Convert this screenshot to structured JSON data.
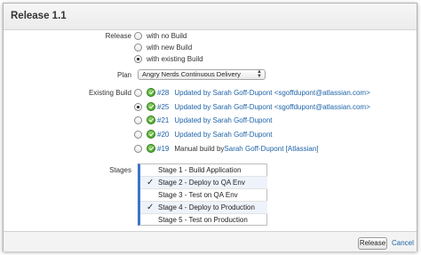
{
  "dialog": {
    "title": "Release 1.1",
    "release_button": "Release",
    "cancel_label": "Cancel"
  },
  "release": {
    "label": "Release",
    "options": [
      {
        "label": "with no Build",
        "checked": false
      },
      {
        "label": "with new Build",
        "checked": false
      },
      {
        "label": "with existing Build",
        "checked": true
      }
    ]
  },
  "plan": {
    "label": "Plan",
    "selected": "Angry Nerds Continuous Delivery"
  },
  "existing_build": {
    "label": "Existing Build",
    "builds": [
      {
        "number": "#28",
        "text": "Updated by Sarah Goff-Dupont <sgoffdupont@atlassian.com>",
        "checked": false
      },
      {
        "number": "#25",
        "text": "Updated by Sarah Goff-Dupont <sgoffdupont@atlassian.com>",
        "checked": true
      },
      {
        "number": "#21",
        "text": "Updated by Sarah Goff-Dupont",
        "checked": false
      },
      {
        "number": "#20",
        "text": "Updated by Sarah Goff-Dupont",
        "checked": false
      },
      {
        "number": "#19",
        "prefix": "Manual build by ",
        "text": "Sarah Goff-Dupont [Atlassian]",
        "checked": false
      }
    ]
  },
  "stages": {
    "label": "Stages",
    "items": [
      {
        "label": "Stage 1 - Build Application",
        "checked": false
      },
      {
        "label": "Stage 2 - Deploy to QA Env",
        "checked": true
      },
      {
        "label": "Stage 3 - Test on QA Env",
        "checked": false
      },
      {
        "label": "Stage 4 - Deploy to Production",
        "checked": true
      },
      {
        "label": "Stage 5 - Test on Production",
        "checked": false
      }
    ]
  },
  "colors": {
    "link": "#1e63a8",
    "status_ok": "#3e9a1f",
    "stage_accent": "#3a76c4"
  }
}
